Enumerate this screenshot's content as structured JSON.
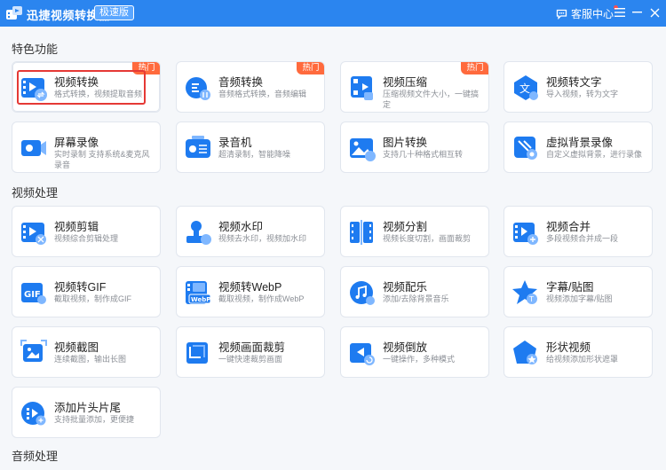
{
  "app": {
    "title": "迅捷视频转换器",
    "edition": "极速版",
    "support_label": "客服中心"
  },
  "colors": {
    "titlebar": "#2b85ef",
    "accent": "#1e7bf0",
    "hot_badge": "#ff6a3d",
    "highlight": "#e53935"
  },
  "sections": {
    "featured": "特色功能",
    "video": "视频处理",
    "audio": "音频处理"
  },
  "featured": [
    {
      "icon": "video-convert-icon",
      "name": "视频转换",
      "desc": "格式转换，视频提取音频",
      "badge": "热门"
    },
    {
      "icon": "audio-convert-icon",
      "name": "音频转换",
      "desc": "音频格式转换，音频编辑",
      "badge": "热门"
    },
    {
      "icon": "video-compress-icon",
      "name": "视频压缩",
      "desc": "压缩视频文件大小，一键搞定",
      "badge": "热门"
    },
    {
      "icon": "video-to-text-icon",
      "name": "视频转文字",
      "desc": "导入视频，转为文字"
    },
    {
      "icon": "screen-record-icon",
      "name": "屏幕录像",
      "desc": "实时录制 支持系统&麦克风录音"
    },
    {
      "icon": "recorder-icon",
      "name": "录音机",
      "desc": "超清录制，智能降噪"
    },
    {
      "icon": "image-convert-icon",
      "name": "图片转换",
      "desc": "支持几十种格式相互转"
    },
    {
      "icon": "virtual-bg-record-icon",
      "name": "虚拟背景录像",
      "desc": "自定义虚拟背景，进行录像"
    }
  ],
  "video_tools": [
    {
      "icon": "video-edit-icon",
      "name": "视频剪辑",
      "desc": "视频综合剪辑处理"
    },
    {
      "icon": "watermark-icon",
      "name": "视频水印",
      "desc": "视频去水印，视频加水印"
    },
    {
      "icon": "video-split-icon",
      "name": "视频分割",
      "desc": "视频长度切割，画面裁剪"
    },
    {
      "icon": "video-merge-icon",
      "name": "视频合并",
      "desc": "多段视频合并成一段"
    },
    {
      "icon": "gif-icon",
      "name": "视频转GIF",
      "desc": "截取视频，制作成GIF"
    },
    {
      "icon": "webp-icon",
      "name": "视频转WebP",
      "desc": "截取视频，制作成WebP"
    },
    {
      "icon": "music-icon",
      "name": "视频配乐",
      "desc": "添加/去除背景音乐"
    },
    {
      "icon": "subtitle-sticker-icon",
      "name": "字幕/贴图",
      "desc": "视频添加字幕/贴图"
    },
    {
      "icon": "screenshot-icon",
      "name": "视频截图",
      "desc": "连续截图，输出长图"
    },
    {
      "icon": "crop-icon",
      "name": "视频画面裁剪",
      "desc": "一键快速裁剪画面"
    },
    {
      "icon": "reverse-icon",
      "name": "视频倒放",
      "desc": "一键操作，多种模式"
    },
    {
      "icon": "shape-video-icon",
      "name": "形状视频",
      "desc": "给视频添加形状遮罩"
    },
    {
      "icon": "intro-outro-icon",
      "name": "添加片头片尾",
      "desc": "支持批量添加，更便捷"
    }
  ]
}
